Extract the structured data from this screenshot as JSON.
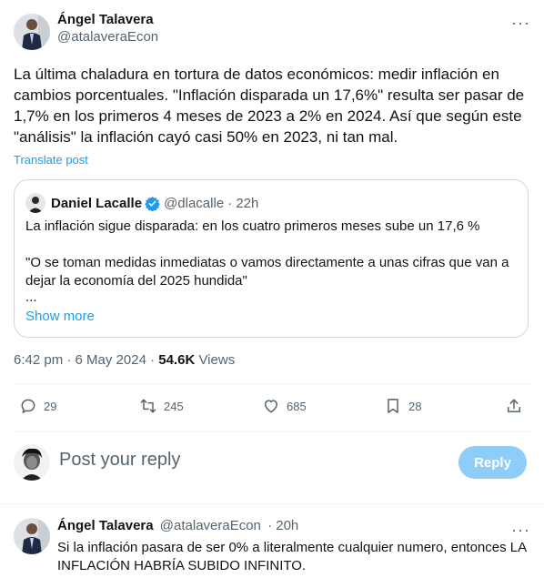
{
  "post": {
    "author_name": "Ángel Talavera",
    "author_handle": "@atalaveraEcon",
    "text": "La última chaladura en tortura de datos económicos: medir inflación en cambios porcentuales. \"Inflación disparada un 17,6%\" resulta ser pasar de 1,7% en los primeros 4 meses de 2023 a 2% en 2024. Así que según este \"análisis\" la inflación cayó casi 50% en 2023, ni tan mal.",
    "translate_label": "Translate post",
    "time": "6:42 pm · 6 May 2024 · ",
    "views_count": "54.6K",
    "views_label": " Views",
    "more_icon": "more-dots-icon"
  },
  "quote": {
    "author_name": "Daniel Lacalle",
    "author_handle": "@dlacalle",
    "time": "· 22h",
    "verified_color": "#1d9bf0",
    "line1": "La inflación sigue disparada: en los cuatro primeros meses sube un 17,6 %",
    "line2": "\"O se toman medidas inmediatas o vamos directamente a unas cifras que van a dejar la economía del 2025 hundida\"",
    "line3": "...",
    "show_more": "Show more"
  },
  "actions": {
    "replies": "29",
    "reposts": "245",
    "likes": "685",
    "bookmarks": "28"
  },
  "composer": {
    "placeholder": "Post your reply",
    "button": "Reply"
  },
  "reply": {
    "author_name": "Ángel Talavera",
    "author_handle": "@atalaveraEcon",
    "time": "· 20h",
    "text": "Si la inflación pasara de ser 0% a literalmente cualquier numero, entonces LA INFLACIÓN HABRÍA SUBIDO INFINITO."
  },
  "colors": {
    "accent": "#1d9bf0",
    "muted": "#536471",
    "reply_button": "#8ecdf8"
  }
}
